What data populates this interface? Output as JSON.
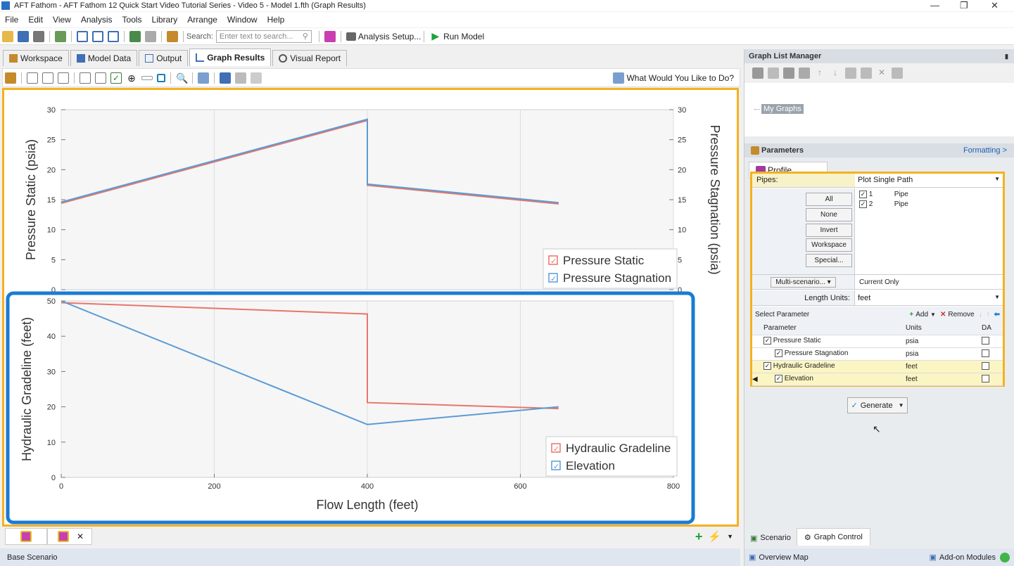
{
  "window": {
    "title": "AFT Fathom - AFT Fathom 12 Quick Start Video Tutorial Series - Video 5 - Model 1.fth (Graph Results)"
  },
  "menu": [
    "File",
    "Edit",
    "View",
    "Analysis",
    "Tools",
    "Library",
    "Arrange",
    "Window",
    "Help"
  ],
  "toolbar": {
    "search_label": "Search:",
    "search_placeholder": "Enter text to search...",
    "analysis_setup": "Analysis Setup...",
    "run_model": "Run Model"
  },
  "tabs": [
    "Workspace",
    "Model Data",
    "Output",
    "Graph Results",
    "Visual Report"
  ],
  "toolbar2": {
    "help_link": "What Would You Like to Do?"
  },
  "chart_data": [
    {
      "type": "line",
      "ylabel": "Pressure Static (psia)",
      "y2label": "Pressure Stagnation (psia)",
      "xlim": [
        0,
        800
      ],
      "ylim": [
        0,
        30
      ],
      "yticks": [
        "0",
        "5",
        "10",
        "15",
        "20",
        "25",
        "30"
      ],
      "series": [
        {
          "name": "Pressure Static",
          "color": "#e8756a",
          "x": [
            0,
            400,
            400,
            650
          ],
          "y": [
            14.4,
            28.2,
            17.4,
            14.3
          ]
        },
        {
          "name": "Pressure Stagnation",
          "color": "#5b9bd5",
          "x": [
            0,
            400,
            400,
            650
          ],
          "y": [
            14.6,
            28.4,
            17.6,
            14.5
          ]
        }
      ],
      "legend": "bottom-right"
    },
    {
      "type": "line",
      "ylabel": "Hydraulic Gradeline (feet)",
      "xlabel": "Flow Length (feet)",
      "xlim": [
        0,
        800
      ],
      "ylim": [
        0,
        50
      ],
      "xticks": [
        "0",
        "200",
        "400",
        "600",
        "800"
      ],
      "yticks": [
        "0",
        "10",
        "20",
        "30",
        "40",
        "50"
      ],
      "series": [
        {
          "name": "Hydraulic Gradeline",
          "color": "#e8756a",
          "x": [
            0,
            400,
            400,
            650
          ],
          "y": [
            49.5,
            46.3,
            21.2,
            19.5
          ]
        },
        {
          "name": "Elevation",
          "color": "#5b9bd5",
          "x": [
            0,
            400,
            650
          ],
          "y": [
            50,
            15,
            20
          ]
        }
      ],
      "legend": "bottom-right"
    }
  ],
  "graph_list": {
    "title": "Graph List Manager",
    "item": "My Graphs"
  },
  "parameters": {
    "title": "Parameters",
    "formatting": "Formatting >",
    "profile": "Profile",
    "pipes_label": "Pipes:",
    "pipes_value": "Plot Single Path",
    "pipes": [
      {
        "id": "1",
        "type": "Pipe"
      },
      {
        "id": "2",
        "type": "Pipe"
      }
    ],
    "buttons": [
      "All",
      "None",
      "Invert",
      "Workspace",
      "Special..."
    ],
    "multi_scenario": "Multi-scenario...",
    "current_only": "Current Only",
    "length_units_label": "Length Units:",
    "length_units": "feet",
    "select_param": "Select Parameter",
    "add": "Add",
    "remove": "Remove",
    "col_param": "Parameter",
    "col_units": "Units",
    "col_da": "DA",
    "rows": [
      {
        "name": "Pressure Static",
        "units": "psia"
      },
      {
        "name": "Pressure Stagnation",
        "units": "psia"
      },
      {
        "name": "Hydraulic Gradeline",
        "units": "feet"
      },
      {
        "name": "Elevation",
        "units": "feet"
      }
    ],
    "generate": "Generate"
  },
  "right_tabs": [
    "Scenario",
    "Graph Control"
  ],
  "right_status": {
    "overview": "Overview Map",
    "addon": "Add-on Modules"
  },
  "status": {
    "scenario": "Base Scenario"
  }
}
